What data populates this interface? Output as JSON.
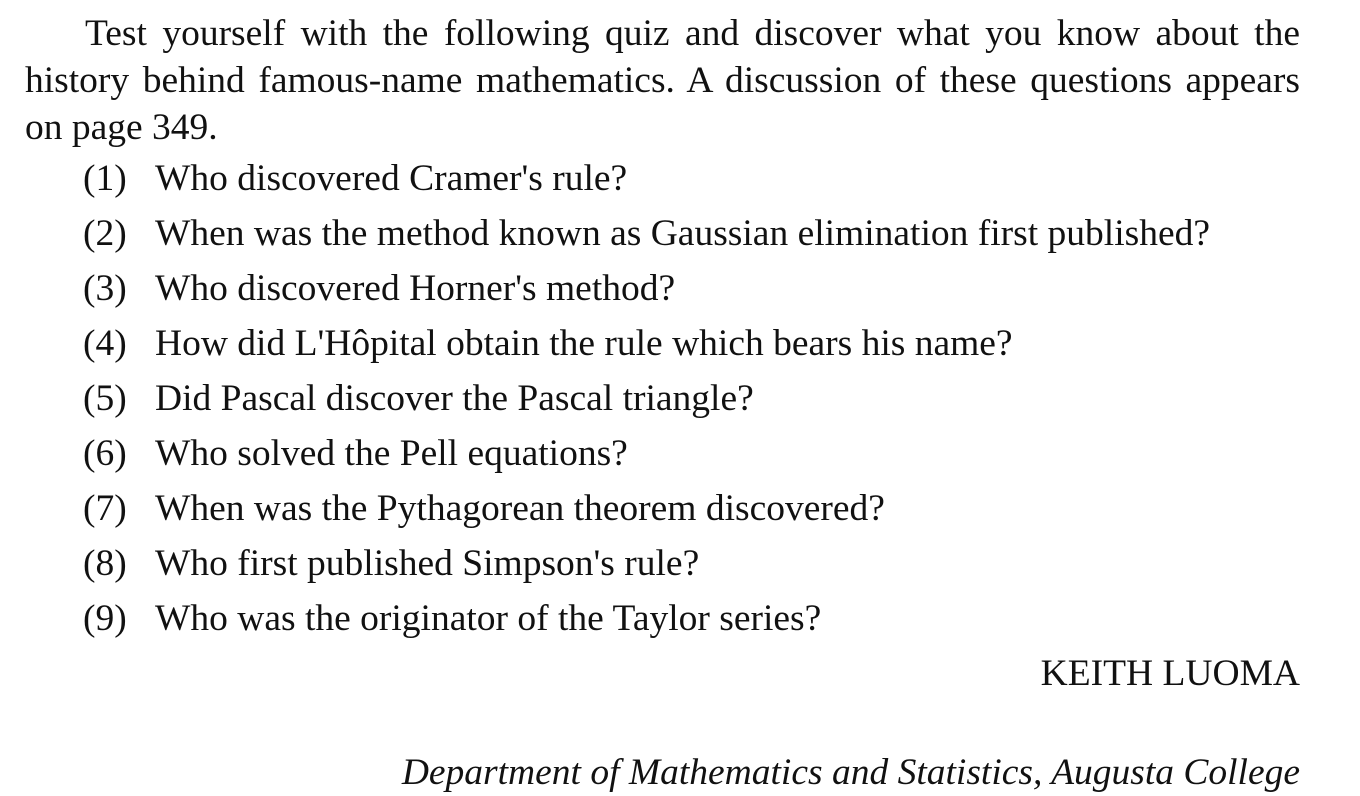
{
  "intro": "Test yourself with the following quiz and discover what you know about the history behind famous-name mathematics.  A discussion of these questions appears on page 349.",
  "questions": [
    {
      "num": "(1)",
      "text": "Who discovered Cramer's rule?"
    },
    {
      "num": "(2)",
      "text": "When was the method known as Gaussian elimination first published?"
    },
    {
      "num": "(3)",
      "text": "Who discovered Horner's method?"
    },
    {
      "num": "(4)",
      "text": "How did L'Hôpital obtain the rule which bears his name?"
    },
    {
      "num": "(5)",
      "text": "Did Pascal discover the Pascal triangle?"
    },
    {
      "num": "(6)",
      "text": "Who solved the Pell equations?"
    },
    {
      "num": "(7)",
      "text": "When was the Pythagorean theorem discovered?"
    },
    {
      "num": "(8)",
      "text": "Who first published Simpson's rule?"
    },
    {
      "num": "(9)",
      "text": "Who was the originator of the Taylor series?"
    }
  ],
  "author": "KEITH LUOMA",
  "affiliation": "Department of Mathematics and Statistics, Augusta College"
}
